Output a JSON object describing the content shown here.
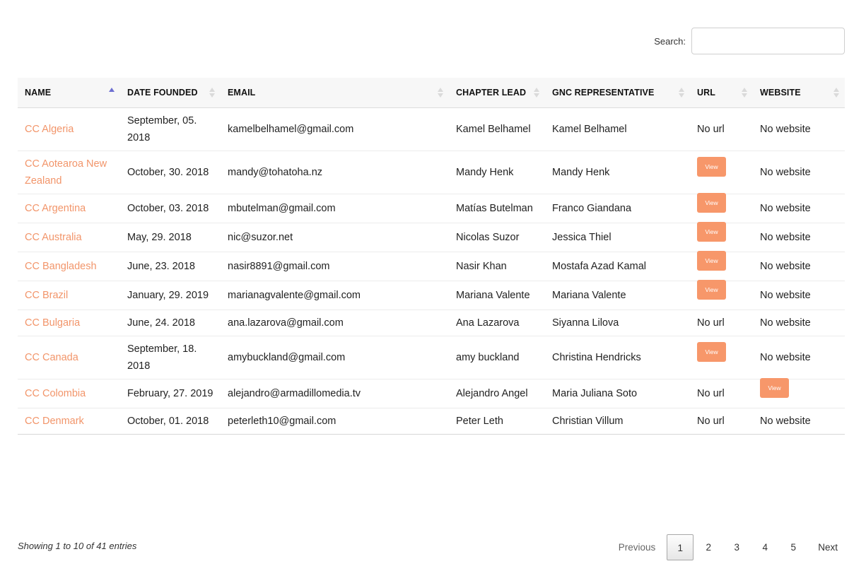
{
  "search": {
    "label": "Search:",
    "value": "",
    "placeholder": ""
  },
  "table": {
    "columns": [
      "NAME",
      "DATE FOUNDED",
      "EMAIL",
      "CHAPTER LEAD",
      "GNC REPRESENTATIVE",
      "URL",
      "WEBSITE"
    ],
    "sorted_column": "NAME",
    "sort_direction": "ascending",
    "rows": [
      {
        "name": "CC Algeria",
        "date": "September, 05. 2018",
        "email": "kamelbelhamel@gmail.com",
        "lead": "Kamel Belhamel",
        "gnc": "Kamel Belhamel",
        "url": "No url",
        "website": "No website"
      },
      {
        "name": "CC Aotearoa New Zealand",
        "date": "October, 30. 2018",
        "email": "mandy@tohatoha.nz",
        "lead": "Mandy Henk",
        "gnc": "Mandy Henk",
        "url": "View",
        "website": "No website"
      },
      {
        "name": "CC Argentina",
        "date": "October, 03. 2018",
        "email": "mbutelman@gmail.com",
        "lead": "Matías Butelman",
        "gnc": "Franco Giandana",
        "url": "View",
        "website": "No website"
      },
      {
        "name": "CC Australia",
        "date": "May, 29. 2018",
        "email": "nic@suzor.net",
        "lead": "Nicolas Suzor",
        "gnc": "Jessica Thiel",
        "url": "View",
        "website": "No website"
      },
      {
        "name": "CC Bangladesh",
        "date": "June, 23. 2018",
        "email": "nasir8891@gmail.com",
        "lead": "Nasir Khan",
        "gnc": "Mostafa Azad Kamal",
        "url": "View",
        "website": "No website"
      },
      {
        "name": "CC Brazil",
        "date": "January, 29. 2019",
        "email": "marianagvalente@gmail.com",
        "lead": "Mariana Valente",
        "gnc": "Mariana Valente",
        "url": "View",
        "website": "No website"
      },
      {
        "name": "CC Bulgaria",
        "date": "June, 24. 2018",
        "email": "ana.lazarova@gmail.com",
        "lead": "Ana Lazarova",
        "gnc": "Siyanna Lilova",
        "url": "No url",
        "website": "No website"
      },
      {
        "name": "CC Canada",
        "date": "September, 18. 2018",
        "email": "amybuckland@gmail.com",
        "lead": "amy buckland",
        "gnc": "Christina Hendricks",
        "url": "View",
        "website": "No website"
      },
      {
        "name": "CC Colombia",
        "date": "February, 27. 2019",
        "email": "alejandro@armadillomedia.tv",
        "lead": "Alejandro Angel",
        "gnc": "Maria Juliana Soto",
        "url": "No url",
        "website": "View"
      },
      {
        "name": "CC Denmark",
        "date": "October, 01. 2018",
        "email": "peterleth10@gmail.com",
        "lead": "Peter Leth",
        "gnc": "Christian Villum",
        "url": "No url",
        "website": "No website"
      }
    ]
  },
  "info": "Showing 1 to 10 of 41 entries",
  "pagination": {
    "previous": "Previous",
    "pages": [
      "1",
      "2",
      "3",
      "4",
      "5"
    ],
    "current": "1",
    "next": "Next"
  },
  "colors": {
    "link": "#f2956a",
    "button": "#f7976a",
    "sort_active": "#6d6fd1"
  }
}
